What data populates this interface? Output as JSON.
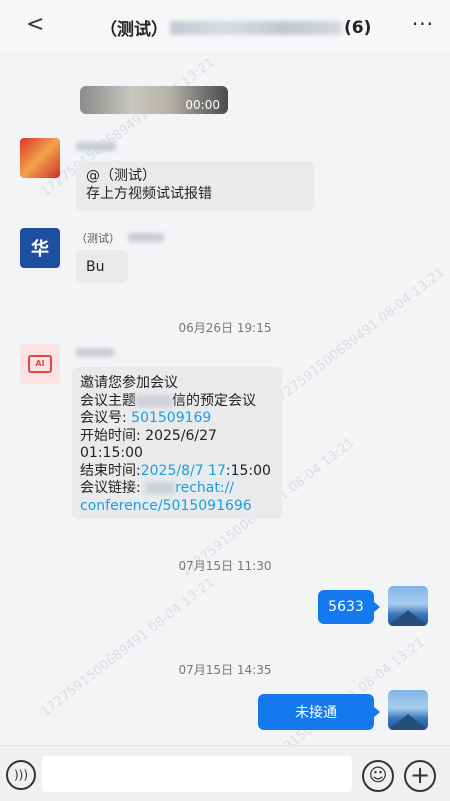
{
  "header": {
    "back": "<",
    "title_prefix": "（测试）",
    "member_count": "(6)",
    "more": "···"
  },
  "watermark": "1727591500689491 08-04 13:21",
  "messages": {
    "video": {
      "duration": "00:00"
    },
    "msg1": {
      "text_line1": "@（测试）",
      "text_line2": "存上方视频试试报错"
    },
    "msg2": {
      "avatar_char": "华",
      "sender_prefix": "（测试）",
      "text": "Bu"
    },
    "time1": "06月26日 19:15",
    "msg3": {
      "avatar_label": "AI",
      "line1": "邀请您参加会议",
      "line2_a": "会议主题",
      "line2_b": "信的预定会议",
      "line3_label": "会议号: ",
      "line3_value": "501509169",
      "line4": "开始时间: 2025/6/27",
      "line5": "01:15:00",
      "line6_label": "结束时间:",
      "line6_link": "2025/8/7 17",
      "line6_rest": ":15:00",
      "line7_label": "会议链接: ",
      "line7_link": "rechat://",
      "line8_link": "conference/5015091696"
    },
    "time2": "07月15日 11:30",
    "my1": "5633",
    "time3": "07月15日 14:35",
    "my2": "未接通"
  },
  "colors": {
    "accent": "#1478ee",
    "link": "#1a9ee0",
    "bubble": "#e9eaec",
    "background": "#f3f4f6"
  },
  "icons": {
    "voice": "voice-icon",
    "emoji": "emoji-icon",
    "plus": "plus-icon"
  }
}
